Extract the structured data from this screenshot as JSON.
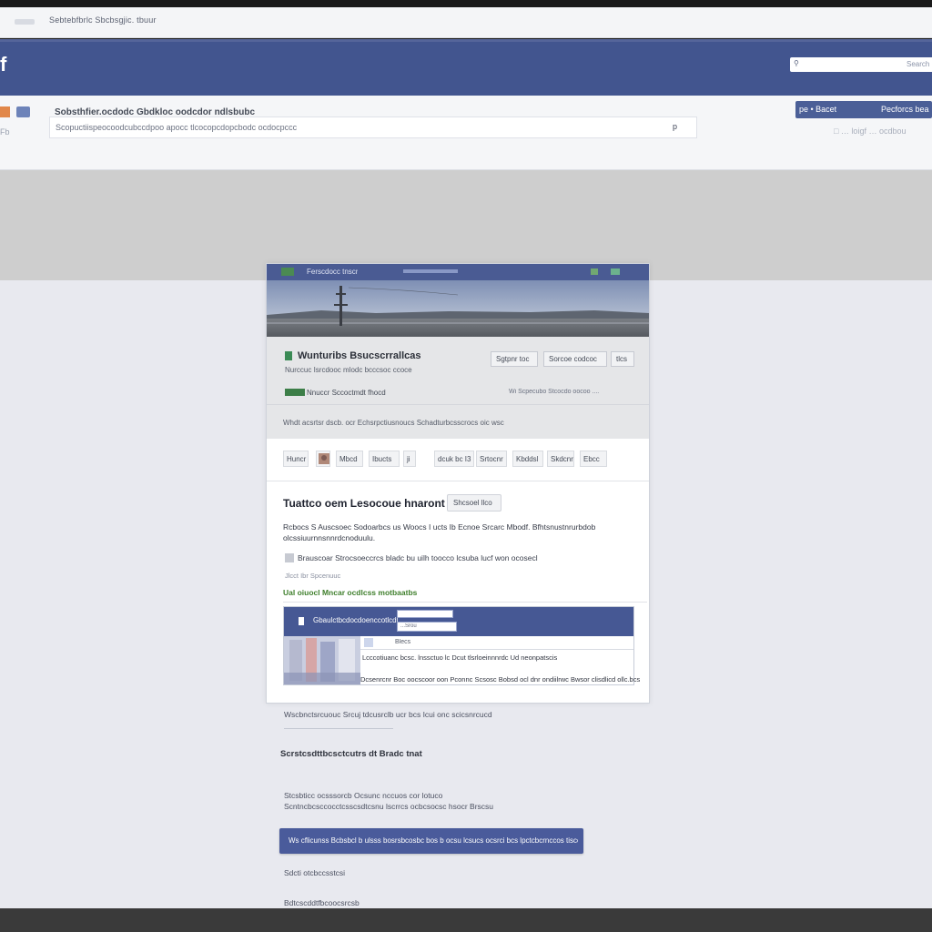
{
  "browser": {
    "tab_title": "Sebtebfbrlc Sbcbsgjic. tbuur"
  },
  "header": {
    "logo": "f",
    "search": {
      "icon": "search-icon",
      "placeholder": "Search"
    }
  },
  "subbar": {
    "title": "Sobsthfier.ocdodc Gbdkloc oodcdor ndlsbubc",
    "input_text": "Scopuctiispeocoodcubccdpoo apocc tlcocopcdopcbodc ocdocpccc",
    "input_button": "p",
    "left_icons": "Fb",
    "button_left": "pe • Bacet",
    "button_right": "Pecforcs bea",
    "right_icons": "□  … loigf  … ocdbou"
  },
  "card": {
    "top_title": "Ferscdocc tnscr",
    "page_name": "Wunturibs Bsucscrrallcas",
    "page_subtitle": "Nurccuc Isrcdooc mlodc bcccsoc ccoce",
    "buttons": [
      "Sgtpnr toc",
      "Sorcoe codcoc",
      "tlcs"
    ],
    "liked_text": "Nnuccr Sccoctmdt fhocd",
    "liked_right": "Wi Scpecubo Stcocdo oocoo   ....",
    "about": "Whdt acsrtsr dscb. ocr Echsrpctiusnoucs Schadturbcsscrocs oic wsc",
    "tabs": [
      "Huncr",
      "Mbcd",
      "Ibucts",
      "ji",
      "dcuk bc I3",
      "Srtocnr",
      "Kbddsl",
      "Skdcnr",
      "Ebcc"
    ],
    "post_title": "Tuattco oem Lesocoue hnaront luvin",
    "post_button": "Shcsoel llco",
    "post_body_1": "Rcbocs  S Auscsoec Sodoarbcs  us  Woocs  I ucts Ib  Ecnoe  Srcarc  Mbodf. Bfhtsnustnrurbdob",
    "post_body_2": "olcssiuurnnsnnrdcnoduulu.",
    "post_meta": "Brauscoar Strocsoeccrcs bladc bu uilh toocco lcsuba lucf won ocosecl",
    "post_date": "Jlcct Ibr  Spcenuuc",
    "post_link": "Ual oiuocl Mncar ocdlcss motbaatbs",
    "embed": {
      "title": "Gbaulctbcdocdoenccotlcdl",
      "input_text": "...Srou",
      "label": "Blecs",
      "text_1": "Lcccotiuanc  bcsc.  lnssctuo lc Dcut tlsrloeinnnrdc Ud neonpatscis",
      "text_2": "Dcsenrcnr Boc oocscoor oon Pconnc Scsosc Bobsd  ocl  dnr ondiilrwc Bwsor clisdlicd ollc.bcs"
    }
  },
  "below": {
    "line_1": "Wscbnctsrcuouc Srcuj tdcusrclb ucr bcs Icui  onc scicsnrcucd",
    "heading": "Scrstcsdttbcsctcutrs dt Bradc tnat",
    "line_2": "Stcsbticc ocsssorcb Ocsunc nccuos cor lotuco",
    "line_3": "Scntncbcsccocctcsscsdtcsnu lscrrcs ocbcsocsc hsocr  Brscsu",
    "button_label": "Ws cflicunss Bcbsbcl b ulsss bosrsbcosbc bos b ocsu lcsucs ocsrci bcs lpctcbcrnccos tisccnsscrnc",
    "line_4": "Sdcti otcbccsstcsi",
    "line_5": "Bdtcscddtfbcoocsrcsb"
  },
  "colors": {
    "facebook_blue": "#42558f",
    "button_blue": "#4a5b9b",
    "accent_green": "#3f7f2c"
  }
}
